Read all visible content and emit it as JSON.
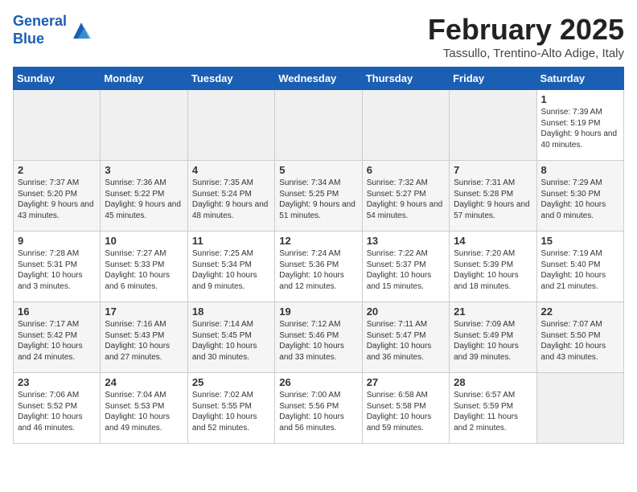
{
  "header": {
    "logo_line1": "General",
    "logo_line2": "Blue",
    "title": "February 2025",
    "subtitle": "Tassullo, Trentino-Alto Adige, Italy"
  },
  "days_of_week": [
    "Sunday",
    "Monday",
    "Tuesday",
    "Wednesday",
    "Thursday",
    "Friday",
    "Saturday"
  ],
  "weeks": [
    [
      {
        "day": "",
        "info": ""
      },
      {
        "day": "",
        "info": ""
      },
      {
        "day": "",
        "info": ""
      },
      {
        "day": "",
        "info": ""
      },
      {
        "day": "",
        "info": ""
      },
      {
        "day": "",
        "info": ""
      },
      {
        "day": "1",
        "info": "Sunrise: 7:39 AM\nSunset: 5:19 PM\nDaylight: 9 hours and 40 minutes."
      }
    ],
    [
      {
        "day": "2",
        "info": "Sunrise: 7:37 AM\nSunset: 5:20 PM\nDaylight: 9 hours and 43 minutes."
      },
      {
        "day": "3",
        "info": "Sunrise: 7:36 AM\nSunset: 5:22 PM\nDaylight: 9 hours and 45 minutes."
      },
      {
        "day": "4",
        "info": "Sunrise: 7:35 AM\nSunset: 5:24 PM\nDaylight: 9 hours and 48 minutes."
      },
      {
        "day": "5",
        "info": "Sunrise: 7:34 AM\nSunset: 5:25 PM\nDaylight: 9 hours and 51 minutes."
      },
      {
        "day": "6",
        "info": "Sunrise: 7:32 AM\nSunset: 5:27 PM\nDaylight: 9 hours and 54 minutes."
      },
      {
        "day": "7",
        "info": "Sunrise: 7:31 AM\nSunset: 5:28 PM\nDaylight: 9 hours and 57 minutes."
      },
      {
        "day": "8",
        "info": "Sunrise: 7:29 AM\nSunset: 5:30 PM\nDaylight: 10 hours and 0 minutes."
      }
    ],
    [
      {
        "day": "9",
        "info": "Sunrise: 7:28 AM\nSunset: 5:31 PM\nDaylight: 10 hours and 3 minutes."
      },
      {
        "day": "10",
        "info": "Sunrise: 7:27 AM\nSunset: 5:33 PM\nDaylight: 10 hours and 6 minutes."
      },
      {
        "day": "11",
        "info": "Sunrise: 7:25 AM\nSunset: 5:34 PM\nDaylight: 10 hours and 9 minutes."
      },
      {
        "day": "12",
        "info": "Sunrise: 7:24 AM\nSunset: 5:36 PM\nDaylight: 10 hours and 12 minutes."
      },
      {
        "day": "13",
        "info": "Sunrise: 7:22 AM\nSunset: 5:37 PM\nDaylight: 10 hours and 15 minutes."
      },
      {
        "day": "14",
        "info": "Sunrise: 7:20 AM\nSunset: 5:39 PM\nDaylight: 10 hours and 18 minutes."
      },
      {
        "day": "15",
        "info": "Sunrise: 7:19 AM\nSunset: 5:40 PM\nDaylight: 10 hours and 21 minutes."
      }
    ],
    [
      {
        "day": "16",
        "info": "Sunrise: 7:17 AM\nSunset: 5:42 PM\nDaylight: 10 hours and 24 minutes."
      },
      {
        "day": "17",
        "info": "Sunrise: 7:16 AM\nSunset: 5:43 PM\nDaylight: 10 hours and 27 minutes."
      },
      {
        "day": "18",
        "info": "Sunrise: 7:14 AM\nSunset: 5:45 PM\nDaylight: 10 hours and 30 minutes."
      },
      {
        "day": "19",
        "info": "Sunrise: 7:12 AM\nSunset: 5:46 PM\nDaylight: 10 hours and 33 minutes."
      },
      {
        "day": "20",
        "info": "Sunrise: 7:11 AM\nSunset: 5:47 PM\nDaylight: 10 hours and 36 minutes."
      },
      {
        "day": "21",
        "info": "Sunrise: 7:09 AM\nSunset: 5:49 PM\nDaylight: 10 hours and 39 minutes."
      },
      {
        "day": "22",
        "info": "Sunrise: 7:07 AM\nSunset: 5:50 PM\nDaylight: 10 hours and 43 minutes."
      }
    ],
    [
      {
        "day": "23",
        "info": "Sunrise: 7:06 AM\nSunset: 5:52 PM\nDaylight: 10 hours and 46 minutes."
      },
      {
        "day": "24",
        "info": "Sunrise: 7:04 AM\nSunset: 5:53 PM\nDaylight: 10 hours and 49 minutes."
      },
      {
        "day": "25",
        "info": "Sunrise: 7:02 AM\nSunset: 5:55 PM\nDaylight: 10 hours and 52 minutes."
      },
      {
        "day": "26",
        "info": "Sunrise: 7:00 AM\nSunset: 5:56 PM\nDaylight: 10 hours and 56 minutes."
      },
      {
        "day": "27",
        "info": "Sunrise: 6:58 AM\nSunset: 5:58 PM\nDaylight: 10 hours and 59 minutes."
      },
      {
        "day": "28",
        "info": "Sunrise: 6:57 AM\nSunset: 5:59 PM\nDaylight: 11 hours and 2 minutes."
      },
      {
        "day": "",
        "info": ""
      }
    ]
  ]
}
